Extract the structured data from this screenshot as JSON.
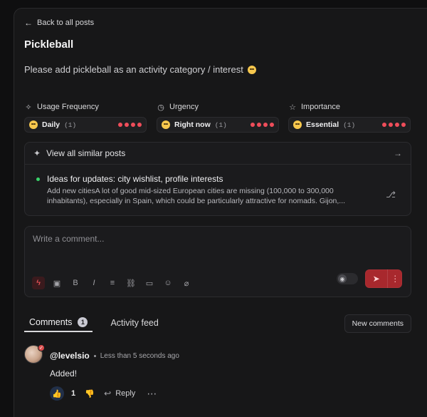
{
  "nav": {
    "back_label": "Back to all posts"
  },
  "post": {
    "title": "Pickleball",
    "description": "Please add pickleball as an activity category / interest"
  },
  "metrics": [
    {
      "label": "Usage Frequency",
      "value": "Daily",
      "count": "(1)",
      "level_dots": 4
    },
    {
      "label": "Urgency",
      "value": "Right now",
      "count": "(1)",
      "level_dots": 4
    },
    {
      "label": "Importance",
      "value": "Essential",
      "count": "(1)",
      "level_dots": 4
    }
  ],
  "similar": {
    "header_label": "View all similar posts",
    "items": [
      {
        "title": "Ideas for updates: city wishlist, profile interests",
        "excerpt": "Add new citiesA lot of good mid-sized European cities are missing (100,000 to 300,000 inhabitants), especially in Spain, which could be particularly attractive for nomads. Gijon,..."
      }
    ]
  },
  "composer": {
    "placeholder": "Write a comment...",
    "toolbar_icons": [
      "lightning-icon",
      "image-icon",
      "bold-icon",
      "italic-icon",
      "list-icon",
      "link-icon",
      "video-icon",
      "emoji-icon",
      "attachment-icon"
    ]
  },
  "tabs": [
    {
      "label": "Comments",
      "badge": "1",
      "active": true
    },
    {
      "label": "Activity feed",
      "badge": null,
      "active": false
    }
  ],
  "new_comments_label": "New comments",
  "comments": [
    {
      "username": "@levelsio",
      "time": "Less than 5 seconds ago",
      "text": "Added!",
      "likes": "1",
      "reply_label": "Reply"
    }
  ],
  "colors": {
    "accent_red": "#ef4d5a",
    "send_red": "#a8282d",
    "online_green": "#39d36a",
    "like_blue": "#6aa6ff"
  }
}
